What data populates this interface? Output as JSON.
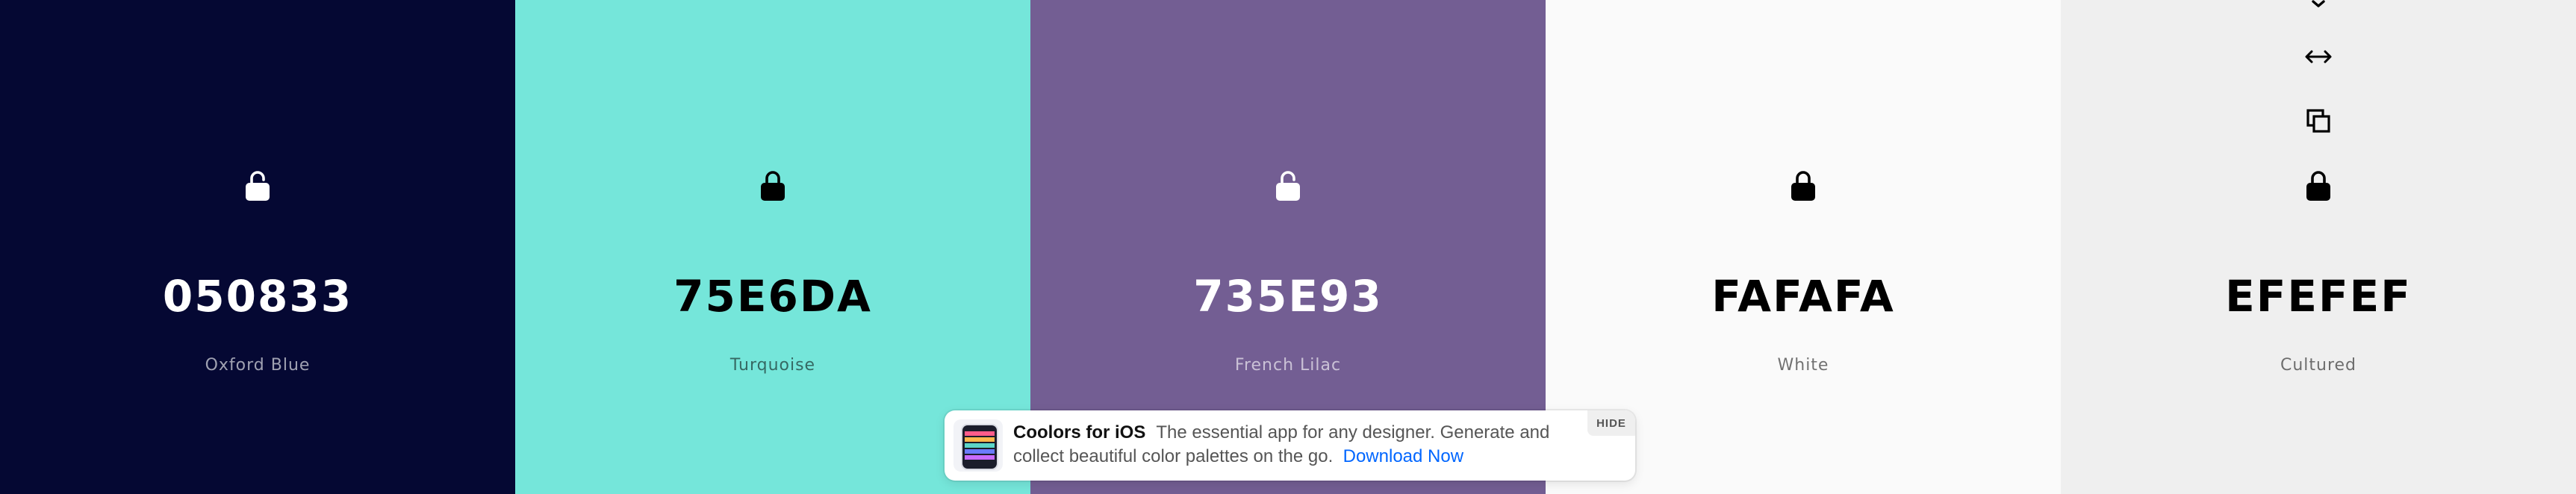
{
  "swatches": [
    {
      "hex": "050833",
      "name": "Oxford Blue",
      "bg": "#050833",
      "theme": "dark",
      "locked": false
    },
    {
      "hex": "75E6DA",
      "name": "Turquoise",
      "bg": "#75E6DA",
      "theme": "light",
      "locked": true
    },
    {
      "hex": "735E93",
      "name": "French Lilac",
      "bg": "#735E93",
      "theme": "dark",
      "locked": false
    },
    {
      "hex": "FAFAFA",
      "name": "White",
      "bg": "#FAFAFA",
      "theme": "light",
      "locked": true
    },
    {
      "hex": "EFEFEF",
      "name": "Cultured",
      "bg": "#EFEFEF",
      "theme": "light",
      "locked": true,
      "hovered": true
    }
  ],
  "icons": {
    "lock": "lock-icon",
    "unlock": "unlock-icon",
    "drag": "drag-arrows-icon",
    "copy": "copy-icon",
    "remove": "remove-icon"
  },
  "ad": {
    "title": "Coolors for iOS",
    "description": "The essential app for any designer. Generate and collect beautiful color palettes on the go.",
    "link_label": "Download Now",
    "hide_label": "HIDE",
    "link_color": "#0066ff"
  }
}
